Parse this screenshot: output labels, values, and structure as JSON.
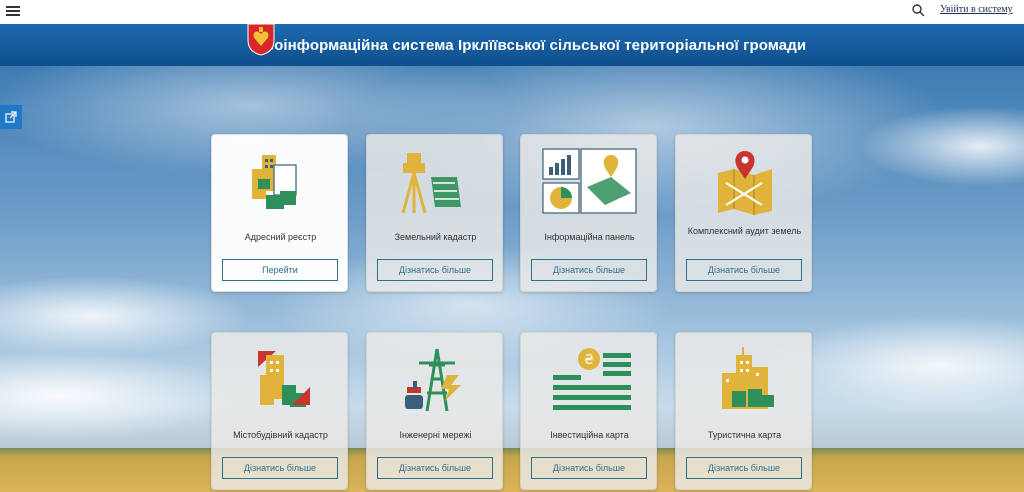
{
  "topbar": {
    "login_label": "Увійти в систему"
  },
  "header": {
    "title": "Геоінформаційна система Ірклїївської сільської територіальної громади"
  },
  "cards": [
    {
      "label": "Адресний реєстр",
      "button": "Перейти"
    },
    {
      "label": "Земельний кадастр",
      "button": "Дізнатись більше"
    },
    {
      "label": "Інформаційна панель",
      "button": "Дізнатись більше"
    },
    {
      "label": "Комплексний аудит земель",
      "button": "Дізнатись більше"
    },
    {
      "label": "Містобудівний кадастр",
      "button": "Дізнатись більше"
    },
    {
      "label": "Інженерні мережі",
      "button": "Дізнатись більше"
    },
    {
      "label": "Інвестиційна карта",
      "button": "Дізнатись більше"
    },
    {
      "label": "Туристична карта",
      "button": "Дізнатись більше"
    }
  ],
  "icons": {
    "menu": "menu-icon",
    "search": "search-icon",
    "crest": "coat-of-arms-icon",
    "share": "share-icon"
  },
  "colors": {
    "header": "#1565a8",
    "accent": "#2f6f8e",
    "gold": "#e0b43a",
    "green": "#2f8f5b",
    "red": "#c8352e"
  }
}
